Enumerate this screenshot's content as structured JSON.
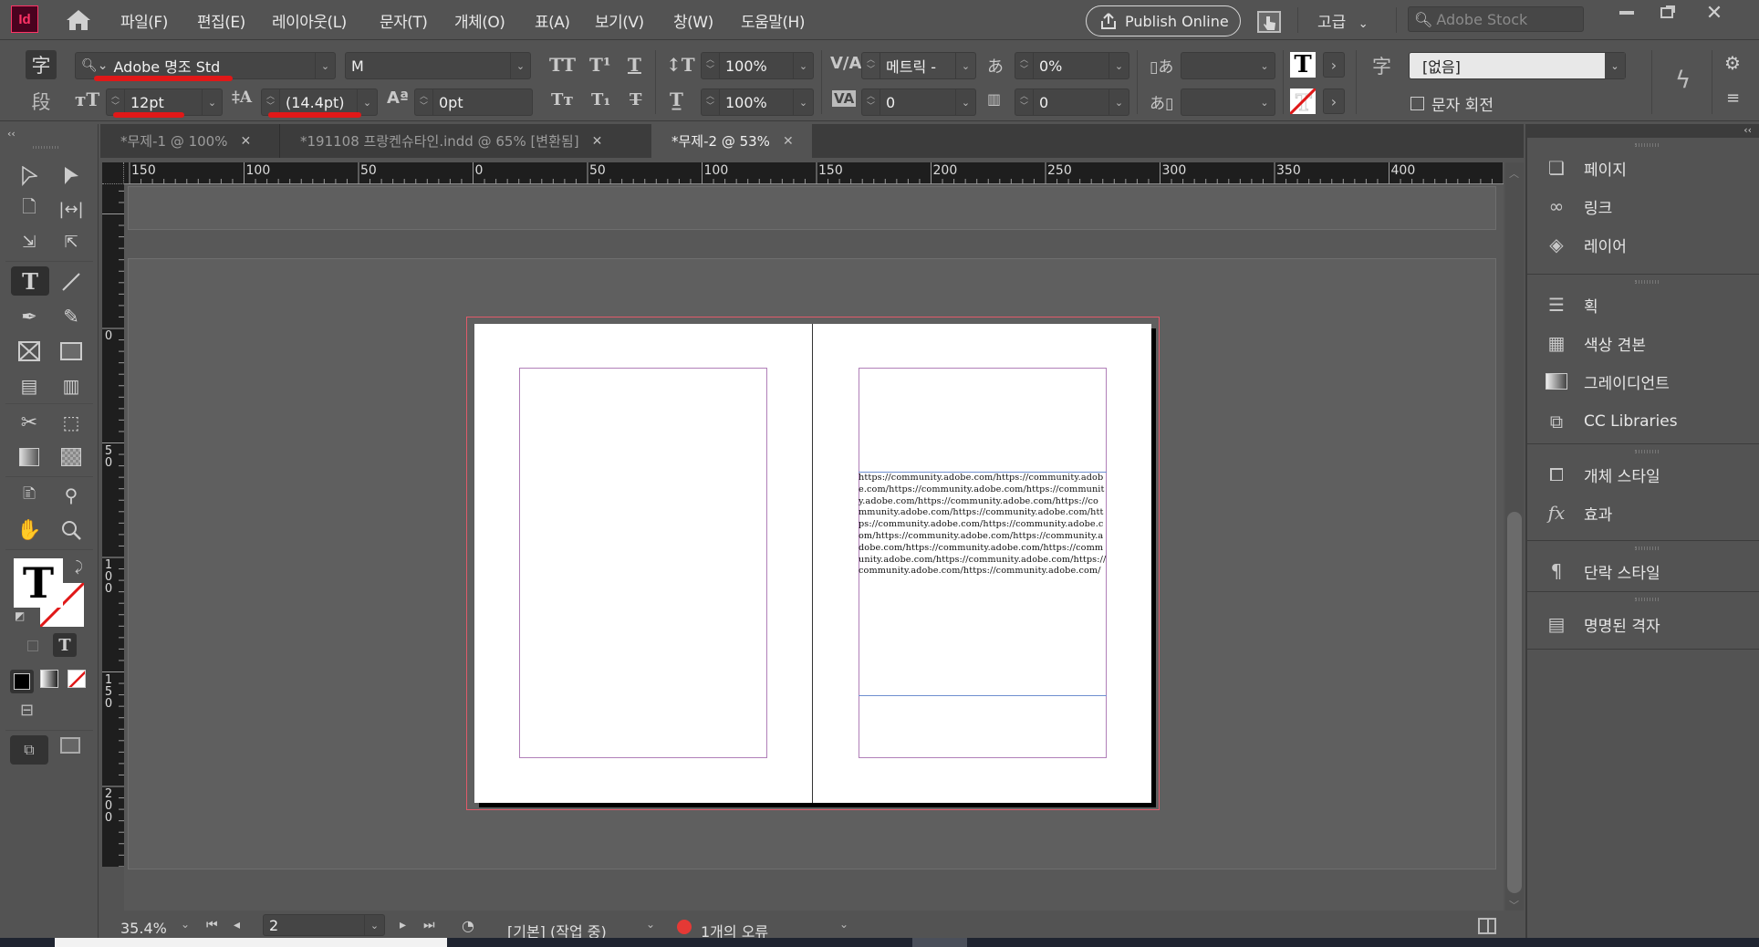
{
  "app": {
    "logo": "Id",
    "menu": [
      "파일(F)",
      "편집(E)",
      "레이아웃(L)",
      "문자(T)",
      "개체(O)",
      "표(A)",
      "보기(V)",
      "창(W)",
      "도움말(H)"
    ],
    "publish_online": "Publish Online",
    "workspace": "고급",
    "stock_placeholder": "Adobe Stock",
    "window_controls": [
      "minimize",
      "restore",
      "close"
    ]
  },
  "control_bar": {
    "char_mode_label": "字",
    "para_mode_label": "段",
    "font_family": "Adobe 명조 Std",
    "font_style": "M",
    "font_size": "12pt",
    "leading": "(14.4pt)",
    "baseline_shift": "0pt",
    "vertical_scale": "100%",
    "horizontal_scale": "100%",
    "kerning": "메트릭 -",
    "tracking": "0",
    "tsume": "0%",
    "grid_count": "0",
    "aki_before": "",
    "aki_after": "",
    "char_style_label": "字",
    "char_style": "[없음]",
    "rotate_char_label": "문자 회전",
    "rotate_char_checked": false,
    "annotation_color": "#e01818"
  },
  "tabs": [
    {
      "label": "*무제-1 @ 100%",
      "active": false
    },
    {
      "label": "*191108 프랑켄슈타인.indd @ 65% [변환됨]",
      "active": false
    },
    {
      "label": "*무제-2 @ 53%",
      "active": true
    }
  ],
  "rulers": {
    "horizontal": [
      "150",
      "100",
      "50",
      "0",
      "50",
      "100",
      "150",
      "200",
      "250",
      "300",
      "350",
      "400"
    ],
    "vertical": [
      "0",
      "50",
      "100",
      "150",
      "200"
    ]
  },
  "document": {
    "text_frame_content": "https://community.adobe.com/https://community.adobe.com/https://community.adobe.com/https://community.adobe.com/https://community.adobe.com/https://community.adobe.com/https://community.adobe.com/https://community.adobe.com/https://community.adobe.com/https://community.adobe.com/https://community.adobe.com/https://community.adobe.com/https://community.adobe.com/https://community.adobe.com/https://community.adobe.com/https://community.adobe.com/"
  },
  "panels": [
    {
      "group": 1,
      "items": [
        {
          "icon": "pages-icon",
          "label": "페이지"
        },
        {
          "icon": "links-icon",
          "label": "링크"
        },
        {
          "icon": "layers-icon",
          "label": "레이어"
        }
      ]
    },
    {
      "group": 2,
      "items": [
        {
          "icon": "stroke-icon",
          "label": "획"
        },
        {
          "icon": "swatches-icon",
          "label": "색상 견본"
        },
        {
          "icon": "gradient-icon",
          "label": "그레이디언트"
        },
        {
          "icon": "cc-libraries-icon",
          "label": "CC Libraries"
        }
      ]
    },
    {
      "group": 3,
      "items": [
        {
          "icon": "object-styles-icon",
          "label": "개체 스타일"
        },
        {
          "icon": "effects-icon",
          "label": "효과"
        }
      ]
    },
    {
      "group": 4,
      "items": [
        {
          "icon": "paragraph-styles-icon",
          "label": "단락 스타일"
        }
      ]
    },
    {
      "group": 5,
      "items": [
        {
          "icon": "named-grids-icon",
          "label": "명명된 격자"
        }
      ]
    }
  ],
  "status_bar": {
    "zoom": "35.4%",
    "page": "2",
    "preflight_profile": "[기본] (작업 중)",
    "errors": "1개의 오류",
    "error_color": "#e53935"
  }
}
